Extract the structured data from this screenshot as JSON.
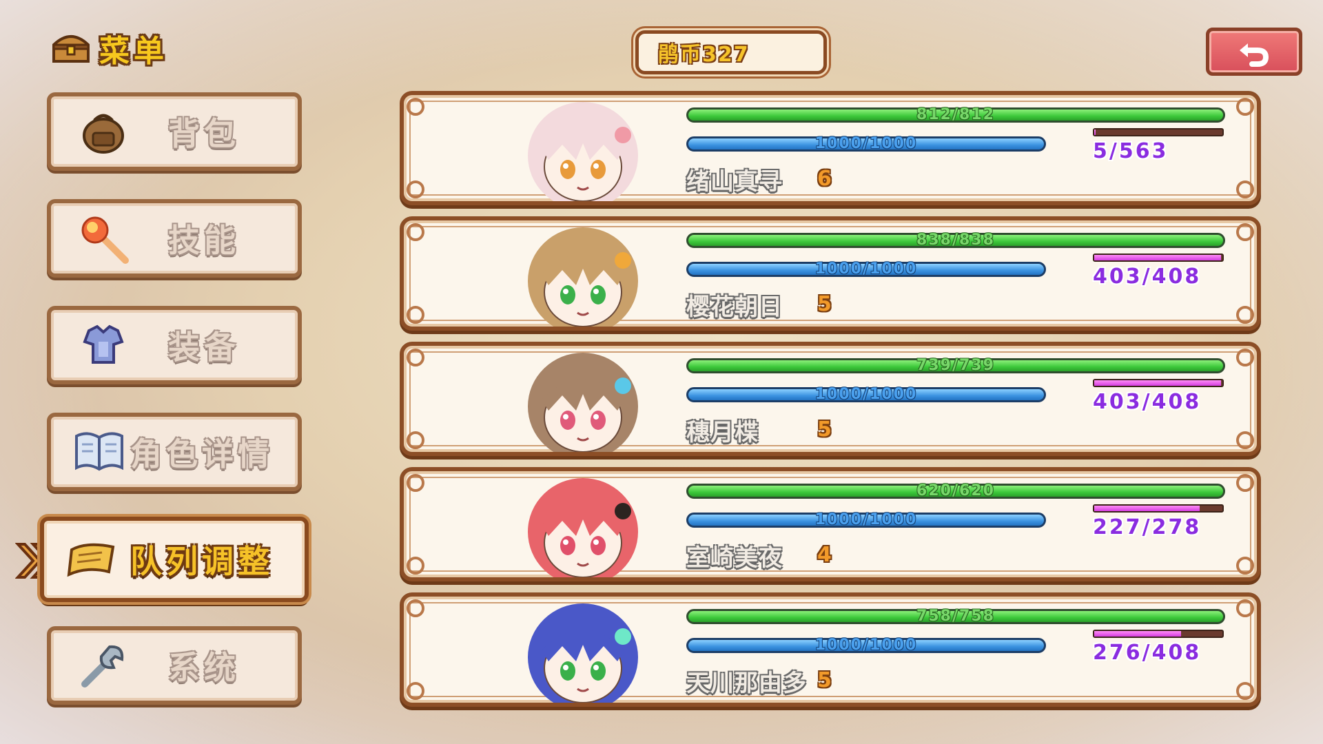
{
  "header": {
    "menu_title": "菜单",
    "currency": "鹃币327"
  },
  "side_menu": [
    {
      "label": "背包",
      "icon": "backpack-icon"
    },
    {
      "label": "技能",
      "icon": "fireball-icon"
    },
    {
      "label": "装备",
      "icon": "armor-icon"
    },
    {
      "label": "角色详情",
      "icon": "book-icon"
    },
    {
      "label": "队列调整",
      "icon": "scroll-icon",
      "selected": true
    },
    {
      "label": "系统",
      "icon": "wrench-icon"
    }
  ],
  "party": [
    {
      "name": "绪山真寻",
      "level": "6",
      "hp": "812/812",
      "hp_ratio": 1.0,
      "mp": "1000/1000",
      "mp_ratio": 1.0,
      "exp": "5/563",
      "exp_ratio": 0.01,
      "hair": "#f3dadd",
      "accent": "#f09aa6",
      "eyes": "#e89a3a"
    },
    {
      "name": "樱花朝日",
      "level": "5",
      "hp": "838/838",
      "hp_ratio": 1.0,
      "mp": "1000/1000",
      "mp_ratio": 1.0,
      "exp": "403/408",
      "exp_ratio": 0.99,
      "hair": "#c9a06a",
      "accent": "#f0a83a",
      "eyes": "#3bb04a"
    },
    {
      "name": "穗月楪",
      "level": "5",
      "hp": "739/739",
      "hp_ratio": 1.0,
      "mp": "1000/1000",
      "mp_ratio": 1.0,
      "exp": "403/408",
      "exp_ratio": 0.99,
      "hair": "#a78468",
      "accent": "#5ac8e8",
      "eyes": "#e05a7a"
    },
    {
      "name": "室崎美夜",
      "level": "4",
      "hp": "620/620",
      "hp_ratio": 1.0,
      "mp": "1000/1000",
      "mp_ratio": 1.0,
      "exp": "227/278",
      "exp_ratio": 0.82,
      "hair": "#e8646a",
      "accent": "#2c2420",
      "eyes": "#e0506a"
    },
    {
      "name": "天川那由多",
      "level": "5",
      "hp": "758/758",
      "hp_ratio": 1.0,
      "mp": "1000/1000",
      "mp_ratio": 1.0,
      "exp": "276/408",
      "exp_ratio": 0.68,
      "hair": "#4a58c8",
      "accent": "#6ee8c8",
      "eyes": "#3ab04a"
    }
  ]
}
